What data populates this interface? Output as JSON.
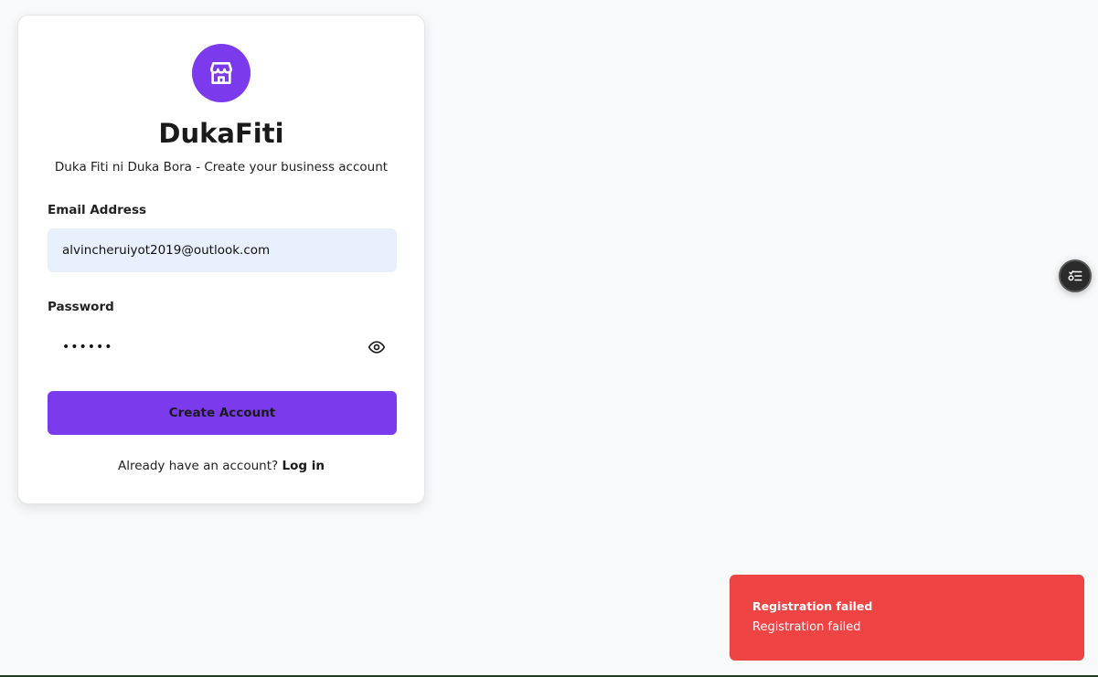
{
  "brand": {
    "name": "DukaFiti",
    "tagline": "Duka Fiti ni Duka Bora - Create your business account",
    "logo_icon": "store-icon",
    "accent_color": "#7c3aed"
  },
  "form": {
    "email_label": "Email Address",
    "email_value": "alvincheruiyot2019@outlook.com",
    "password_label": "Password",
    "password_value": "••••••",
    "password_toggle_icon": "eye-icon",
    "submit_label": "Create Account"
  },
  "login_prompt": {
    "text": "Already have an account?",
    "link_label": "Log in"
  },
  "floating_button": {
    "icon": "list-settings-icon"
  },
  "toast": {
    "title": "Registration failed",
    "description": "Registration failed",
    "color": "#ef4444"
  }
}
